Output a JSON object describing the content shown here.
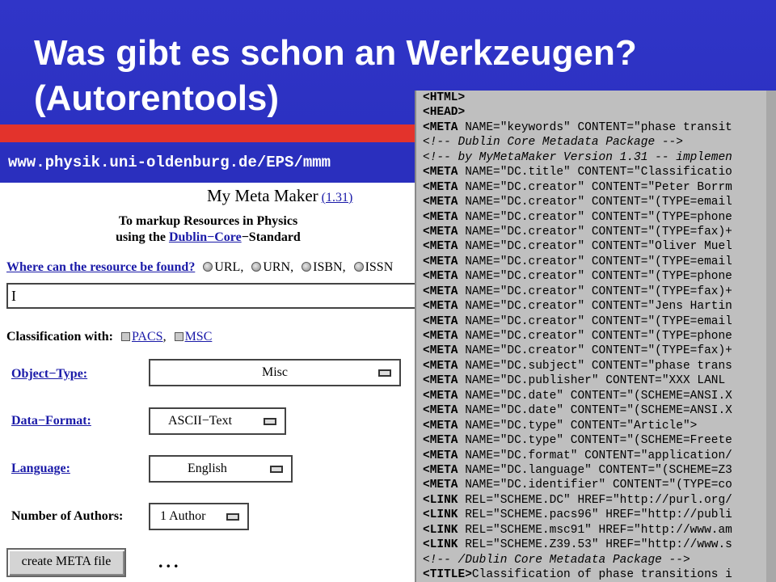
{
  "slide": {
    "title_line1": "Was gibt es schon an Werkzeugen?",
    "title_line2": "(Autorentools)",
    "url": "www.physik.uni-oldenburg.de/EPS/mmm"
  },
  "form": {
    "app_name": "My Meta Maker",
    "version_link": "(1.31)",
    "subtitle_line1": "To markup Resources in Physics",
    "subtitle_pre": "using the ",
    "subtitle_link": "Dublin−Core",
    "subtitle_post": "−Standard",
    "where_question": "Where can the resource be found?",
    "resource_options": [
      "URL,",
      "URN,",
      "ISBN,",
      "ISSN"
    ],
    "resource_input_value": "I",
    "classification_label": "Classification with:",
    "classification_options": [
      "PACS",
      "MSC"
    ],
    "object_type_label": "Object−Type:",
    "object_type_value": "Misc",
    "data_format_label": "Data−Format:",
    "data_format_value": "ASCII−Text",
    "language_label": "Language:",
    "language_value": "English",
    "authors_label": "Number of Authors:",
    "authors_value": "1 Author",
    "create_button": "create META file",
    "ellipsis": "..."
  },
  "code": {
    "lines": [
      {
        "tag": "<HTML>",
        "rest": ""
      },
      {
        "tag": "<HEAD>",
        "rest": ""
      },
      {
        "tag": "<META",
        "rest": " NAME=\"keywords\" CONTENT=\"phase transit"
      },
      {
        "comment": "<!-- Dublin Core Metadata Package -->"
      },
      {
        "comment": "<!-- by MyMetaMaker Version 1.31 -- implemen"
      },
      {
        "tag": "<META",
        "rest": " NAME=\"DC.title\" CONTENT=\"Classificatio"
      },
      {
        "tag": "<META",
        "rest": " NAME=\"DC.creator\" CONTENT=\"Peter Borrm"
      },
      {
        "tag": "<META",
        "rest": " NAME=\"DC.creator\" CONTENT=\"(TYPE=email"
      },
      {
        "tag": "<META",
        "rest": " NAME=\"DC.creator\" CONTENT=\"(TYPE=phone"
      },
      {
        "tag": "<META",
        "rest": " NAME=\"DC.creator\" CONTENT=\"(TYPE=fax)+"
      },
      {
        "tag": "<META",
        "rest": " NAME=\"DC.creator\" CONTENT=\"Oliver Muel"
      },
      {
        "tag": "<META",
        "rest": " NAME=\"DC.creator\" CONTENT=\"(TYPE=email"
      },
      {
        "tag": "<META",
        "rest": " NAME=\"DC.creator\" CONTENT=\"(TYPE=phone"
      },
      {
        "tag": "<META",
        "rest": " NAME=\"DC.creator\" CONTENT=\"(TYPE=fax)+"
      },
      {
        "tag": "<META",
        "rest": " NAME=\"DC.creator\" CONTENT=\"Jens Hartin"
      },
      {
        "tag": "<META",
        "rest": " NAME=\"DC.creator\" CONTENT=\"(TYPE=email"
      },
      {
        "tag": "<META",
        "rest": " NAME=\"DC.creator\" CONTENT=\"(TYPE=phone"
      },
      {
        "tag": "<META",
        "rest": " NAME=\"DC.creator\" CONTENT=\"(TYPE=fax)+"
      },
      {
        "tag": "<META",
        "rest": " NAME=\"DC.subject\" CONTENT=\"phase trans"
      },
      {
        "tag": "<META",
        "rest": " NAME=\"DC.publisher\" CONTENT=\"XXX LANL"
      },
      {
        "tag": "<META",
        "rest": " NAME=\"DC.date\" CONTENT=\"(SCHEME=ANSI.X"
      },
      {
        "tag": "<META",
        "rest": " NAME=\"DC.date\" CONTENT=\"(SCHEME=ANSI.X"
      },
      {
        "tag": "<META",
        "rest": " NAME=\"DC.type\" CONTENT=\"Article\">"
      },
      {
        "tag": "<META",
        "rest": " NAME=\"DC.type\" CONTENT=\"(SCHEME=Freete"
      },
      {
        "tag": "<META",
        "rest": " NAME=\"DC.format\" CONTENT=\"application/"
      },
      {
        "tag": "<META",
        "rest": " NAME=\"DC.language\" CONTENT=\"(SCHEME=Z3"
      },
      {
        "tag": "<META",
        "rest": " NAME=\"DC.identifier\" CONTENT=\"(TYPE=co"
      },
      {
        "tag": "<LINK",
        "rest": " REL=\"SCHEME.DC\" HREF=\"http://purl.org/"
      },
      {
        "tag": "<LINK",
        "rest": " REL=\"SCHEME.pacs96\" HREF=\"http://publi"
      },
      {
        "tag": "<LINK",
        "rest": " REL=\"SCHEME.msc91\" HREF=\"http://www.am"
      },
      {
        "tag": "<LINK",
        "rest": " REL=\"SCHEME.Z39.53\" HREF=\"http://www.s"
      },
      {
        "comment": "<!-- /Dublin Core Metadata Package -->"
      },
      {
        "tag": "<TITLE>",
        "rest": "Classification of phase transitions i"
      }
    ]
  },
  "colors": {
    "background_blue": "#2d31c9",
    "accent_red": "#e3332c",
    "link_blue": "#1a1aa8",
    "code_bg": "#bfbfbf"
  }
}
